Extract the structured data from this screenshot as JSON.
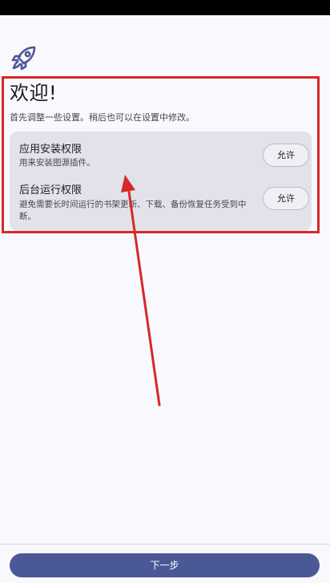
{
  "welcome": {
    "title": "欢迎!",
    "subtitle": "首先调整一些设置。稍后也可以在设置中修改。",
    "icon": "rocket-icon"
  },
  "permissions": [
    {
      "title": "应用安装权限",
      "description": "用来安装图源插件。",
      "button": "允许"
    },
    {
      "title": "后台运行权限",
      "description": "避免需要长时间运行的书架更新、下载、备份恢复任务受到中断。",
      "button": "允许"
    }
  ],
  "footer": {
    "next_label": "下一步"
  },
  "colors": {
    "accent": "#4b5896",
    "annotation": "#d62828",
    "card": "#e3e1ea",
    "background": "#f9f8fd"
  }
}
